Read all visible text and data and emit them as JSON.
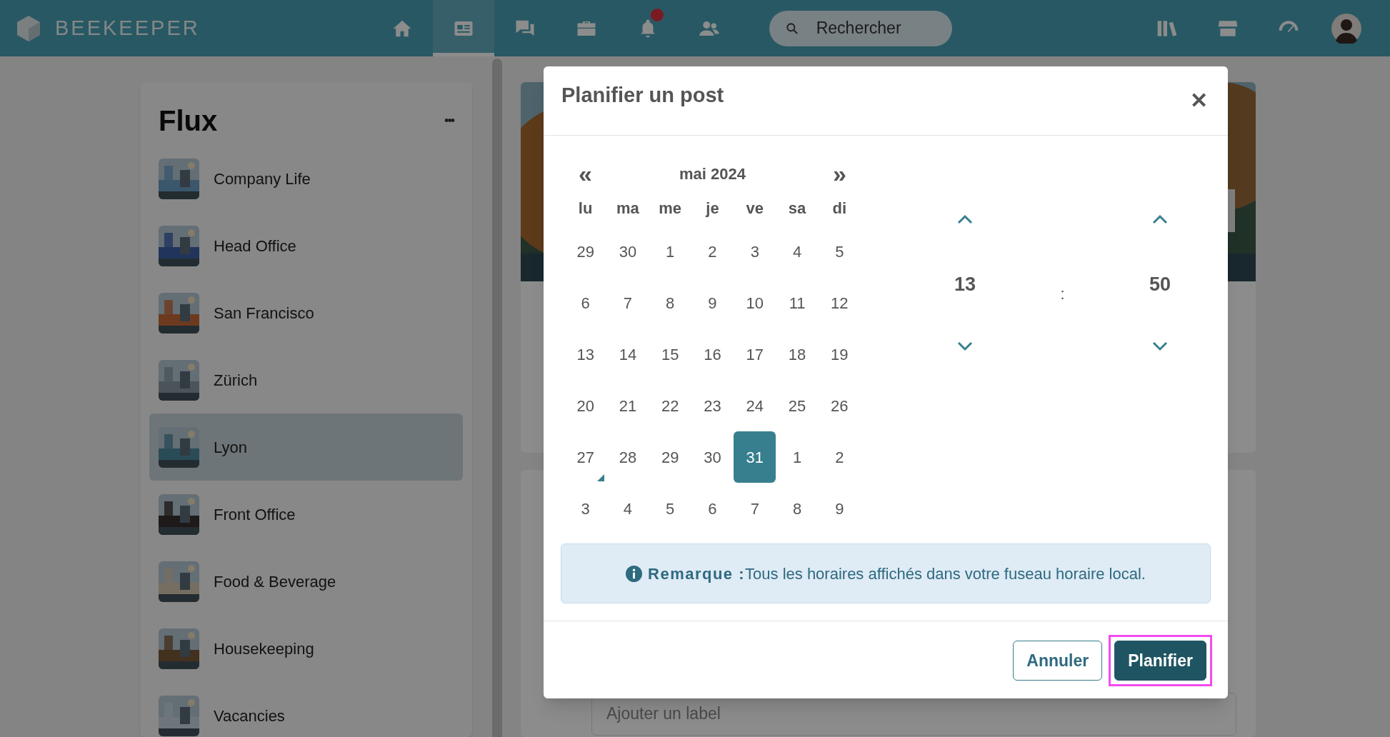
{
  "topbar": {
    "brand": "BEEKEEPER",
    "nav": [
      {
        "selected": false,
        "badge": false
      },
      {
        "selected": true,
        "badge": false
      },
      {
        "selected": false,
        "badge": false
      },
      {
        "selected": false,
        "badge": false
      },
      {
        "selected": false,
        "badge": true
      },
      {
        "selected": false,
        "badge": false
      }
    ],
    "search": {
      "placeholder": "Rechercher"
    }
  },
  "sidebar": {
    "title": "Flux",
    "more": "•••",
    "items": [
      {
        "label": "Company Life",
        "selected": false
      },
      {
        "label": "Head Office",
        "selected": false
      },
      {
        "label": "San Francisco",
        "selected": false
      },
      {
        "label": "Zürich",
        "selected": false
      },
      {
        "label": "Lyon",
        "selected": true
      },
      {
        "label": "Front Office",
        "selected": false
      },
      {
        "label": "Food & Beverage",
        "selected": false
      },
      {
        "label": "Housekeeping",
        "selected": false
      },
      {
        "label": "Vacancies",
        "selected": false
      }
    ]
  },
  "feed": {
    "label_field": {
      "placeholder": "Ajouter un label"
    }
  },
  "dialog": {
    "title": "Planifier un post",
    "close": "✕",
    "calendar": {
      "prev": "«",
      "month": "mai 2024",
      "next": "»",
      "weekdays": [
        "lu",
        "ma",
        "me",
        "je",
        "ve",
        "sa",
        "di"
      ],
      "weeks": [
        [
          {
            "label": "29",
            "selected": false,
            "today": false
          },
          {
            "label": "30",
            "selected": false,
            "today": false
          },
          {
            "label": "1",
            "selected": false,
            "today": false
          },
          {
            "label": "2",
            "selected": false,
            "today": false
          },
          {
            "label": "3",
            "selected": false,
            "today": false
          },
          {
            "label": "4",
            "selected": false,
            "today": false
          },
          {
            "label": "5",
            "selected": false,
            "today": false
          }
        ],
        [
          {
            "label": "6",
            "selected": false,
            "today": false
          },
          {
            "label": "7",
            "selected": false,
            "today": false
          },
          {
            "label": "8",
            "selected": false,
            "today": false
          },
          {
            "label": "9",
            "selected": false,
            "today": false
          },
          {
            "label": "10",
            "selected": false,
            "today": false
          },
          {
            "label": "11",
            "selected": false,
            "today": false
          },
          {
            "label": "12",
            "selected": false,
            "today": false
          }
        ],
        [
          {
            "label": "13",
            "selected": false,
            "today": false
          },
          {
            "label": "14",
            "selected": false,
            "today": false
          },
          {
            "label": "15",
            "selected": false,
            "today": false
          },
          {
            "label": "16",
            "selected": false,
            "today": false
          },
          {
            "label": "17",
            "selected": false,
            "today": false
          },
          {
            "label": "18",
            "selected": false,
            "today": false
          },
          {
            "label": "19",
            "selected": false,
            "today": false
          }
        ],
        [
          {
            "label": "20",
            "selected": false,
            "today": false
          },
          {
            "label": "21",
            "selected": false,
            "today": false
          },
          {
            "label": "22",
            "selected": false,
            "today": false
          },
          {
            "label": "23",
            "selected": false,
            "today": false
          },
          {
            "label": "24",
            "selected": false,
            "today": false
          },
          {
            "label": "25",
            "selected": false,
            "today": false
          },
          {
            "label": "26",
            "selected": false,
            "today": false
          }
        ],
        [
          {
            "label": "27",
            "selected": false,
            "today": true
          },
          {
            "label": "28",
            "selected": false,
            "today": false
          },
          {
            "label": "29",
            "selected": false,
            "today": false
          },
          {
            "label": "30",
            "selected": false,
            "today": false
          },
          {
            "label": "31",
            "selected": true,
            "today": false
          },
          {
            "label": "1",
            "selected": false,
            "today": false
          },
          {
            "label": "2",
            "selected": false,
            "today": false
          }
        ],
        [
          {
            "label": "3",
            "selected": false,
            "today": false
          },
          {
            "label": "4",
            "selected": false,
            "today": false
          },
          {
            "label": "5",
            "selected": false,
            "today": false
          },
          {
            "label": "6",
            "selected": false,
            "today": false
          },
          {
            "label": "7",
            "selected": false,
            "today": false
          },
          {
            "label": "8",
            "selected": false,
            "today": false
          },
          {
            "label": "9",
            "selected": false,
            "today": false
          }
        ]
      ]
    },
    "time": {
      "hours": "13",
      "separator": ":",
      "minutes": "50"
    },
    "note": "**Remarque :**Tous les horaires affichés dans votre fuseau horaire local.",
    "buttons": [
      {
        "label": "Annuler",
        "kind": "secondary",
        "focused": false
      },
      {
        "label": "Planifier",
        "kind": "primary",
        "focused": true
      }
    ]
  }
}
